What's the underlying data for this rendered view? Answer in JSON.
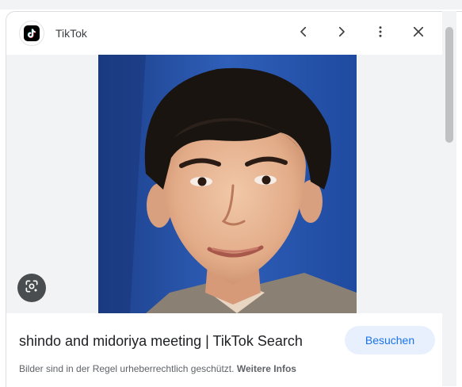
{
  "header": {
    "source_name": "TikTok",
    "logo_icon": "tiktok-logo-icon",
    "prev_icon": "chevron-left-icon",
    "next_icon": "chevron-right-icon",
    "more_icon": "more-vert-icon",
    "close_icon": "close-icon"
  },
  "image": {
    "lens_icon": "google-lens-icon",
    "background_color": "#f1f3f4"
  },
  "footer": {
    "title": "shindo and midoriya meeting | TikTok Search",
    "visit_label": "Besuchen",
    "copyright_text": "Bilder sind in der Regel urheberrechtlich geschützt.",
    "copyright_link": "Weitere Infos"
  },
  "colors": {
    "accent": "#1a73e8",
    "visit_bg": "#e8f0fe"
  }
}
